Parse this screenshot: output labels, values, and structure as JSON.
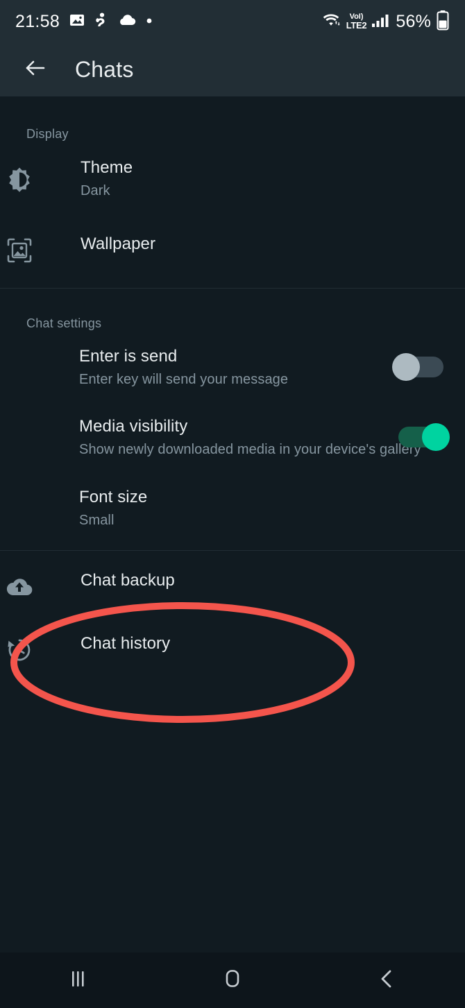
{
  "status_bar": {
    "time": "21:58",
    "left_icons": [
      "image-icon",
      "person-alert-icon",
      "cloud-icon",
      "dot-icon"
    ],
    "network_label_top": "VoI)",
    "network_label_bottom": "LTE2",
    "battery_percent": "56%",
    "right_icons": [
      "wifi-icon",
      "signal-bars-icon",
      "battery-icon"
    ]
  },
  "app_bar": {
    "back_icon": "arrow-left-icon",
    "title": "Chats"
  },
  "sections": [
    {
      "header": "Display",
      "rows": [
        {
          "icon": "brightness-icon",
          "title": "Theme",
          "subtitle": "Dark"
        },
        {
          "icon": "wallpaper-icon",
          "title": "Wallpaper",
          "subtitle": ""
        }
      ]
    },
    {
      "header": "Chat settings",
      "rows": [
        {
          "icon": "",
          "title": "Enter is send",
          "subtitle": "Enter key will send your message",
          "toggle": "off"
        },
        {
          "icon": "",
          "title": "Media visibility",
          "subtitle": "Show newly downloaded media in your device's gallery",
          "toggle": "on"
        },
        {
          "icon": "",
          "title": "Font size",
          "subtitle": "Small"
        }
      ]
    },
    {
      "header": "",
      "rows": [
        {
          "icon": "cloud-upload-icon",
          "title": "Chat backup",
          "subtitle": ""
        },
        {
          "icon": "history-icon",
          "title": "Chat history",
          "subtitle": ""
        }
      ]
    }
  ],
  "annotation": {
    "shape": "ellipse",
    "target": "Chat history",
    "color": "#f4554c"
  },
  "nav_bar": {
    "recents_icon": "recents-icon",
    "home_icon": "home-icon",
    "back_icon": "back-chevron-icon"
  },
  "colors": {
    "background": "#111b21",
    "bar": "#222e35",
    "primary_text": "#e9edef",
    "secondary_text": "#8696a0",
    "accent_green": "#00d3a0",
    "annotation_red": "#f4554c"
  }
}
